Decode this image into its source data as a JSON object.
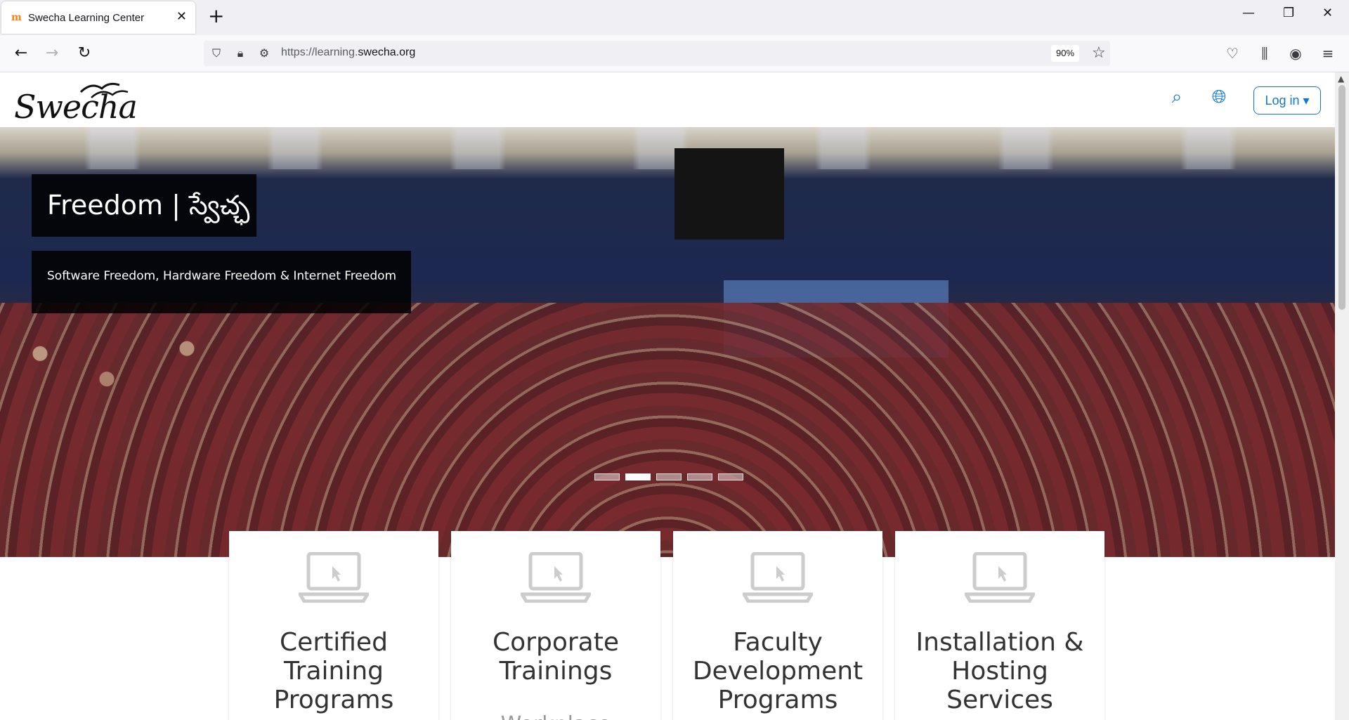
{
  "browser": {
    "tab_title": "Swecha Learning Center",
    "tab_favicon": "m",
    "url_prefix": "https://learning.",
    "url_host": "swecha.org",
    "zoom": "90%"
  },
  "site": {
    "logo_text": "Swecha",
    "login_label": "Log in ▾"
  },
  "hero": {
    "title": "Freedom | స్వేచ్ఛ",
    "subtitle": "Software Freedom, Hardware Freedom & Internet Freedom",
    "slide_count": 5,
    "active_slide": 2
  },
  "cards": [
    {
      "title": "Certified Training Programs",
      "subtitle": ""
    },
    {
      "title": "Corporate Trainings",
      "subtitle": "Workplace"
    },
    {
      "title": "Faculty Development Programs",
      "subtitle": ""
    },
    {
      "title": "Installation & Hosting Services",
      "subtitle": ""
    }
  ],
  "colors": {
    "accent": "#1177d1",
    "card_text": "#333333"
  }
}
